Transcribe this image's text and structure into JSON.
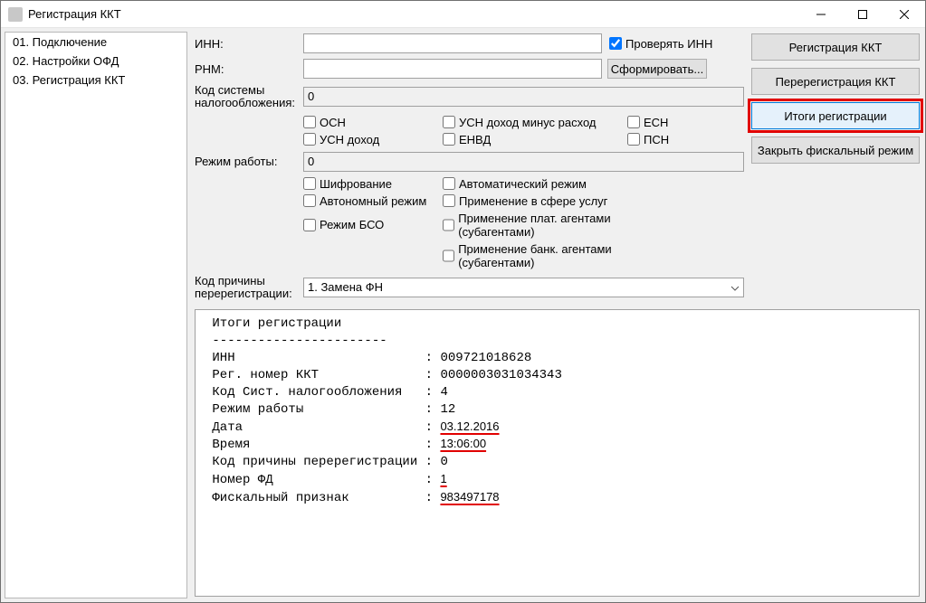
{
  "window": {
    "title": "Регистрация ККТ"
  },
  "sidebar": {
    "items": [
      {
        "label": "01. Подключение"
      },
      {
        "label": "02. Настройки ОФД"
      },
      {
        "label": "03. Регистрация ККТ"
      }
    ]
  },
  "form": {
    "inn_label": "ИНН:",
    "inn_value": "",
    "check_inn_label": "Проверять ИНН",
    "rnm_label": "РНМ:",
    "rnm_value": "",
    "generate_btn": "Сформировать...",
    "tax_code_label": "Код системы налогообложения:",
    "tax_code_value": "0",
    "tax_options": {
      "osn": "ОСН",
      "usn_dmr": "УСН доход минус расход",
      "esn": "ЕСН",
      "usn_d": "УСН доход",
      "envd": "ЕНВД",
      "psn": "ПСН"
    },
    "mode_label": "Режим работы:",
    "mode_value": "0",
    "mode_options": {
      "encrypt": "Шифрование",
      "auto": "Автоматический режим",
      "autonomous": "Автономный режим",
      "services": "Применение в сфере услуг",
      "bso": "Режим БСО",
      "pay_agents": "Применение плат. агентами (субагентами)",
      "bank_agents": "Применение банк. агентами (субагентами)"
    },
    "rereg_reason_label": "Код причины перерегистрации:",
    "rereg_reason_value": "1. Замена ФН"
  },
  "actions": {
    "register": "Регистрация ККТ",
    "reregister": "Перерегистрация ККТ",
    "totals": "Итоги регистрации",
    "close_fiscal": "Закрыть фискальный режим"
  },
  "log": {
    "title": "Итоги регистрации",
    "sep": "-----------------------",
    "rows": [
      {
        "k": "ИНН",
        "v": "009721018628"
      },
      {
        "k": "Рег. номер ККТ",
        "v": "0000003031034343"
      },
      {
        "k": "Код Сист. налогообложения",
        "v": "4"
      },
      {
        "k": "Режим работы",
        "v": "12"
      },
      {
        "k": "Дата",
        "v": "03.12.2016",
        "u": true
      },
      {
        "k": "Время",
        "v": "13:06:00",
        "u": true
      },
      {
        "k": "Код причины перерегистрации",
        "v": "0"
      },
      {
        "k": "Номер ФД",
        "v": "1",
        "u": true
      },
      {
        "k": "Фискальный признак",
        "v": "983497178",
        "u": true
      }
    ]
  }
}
